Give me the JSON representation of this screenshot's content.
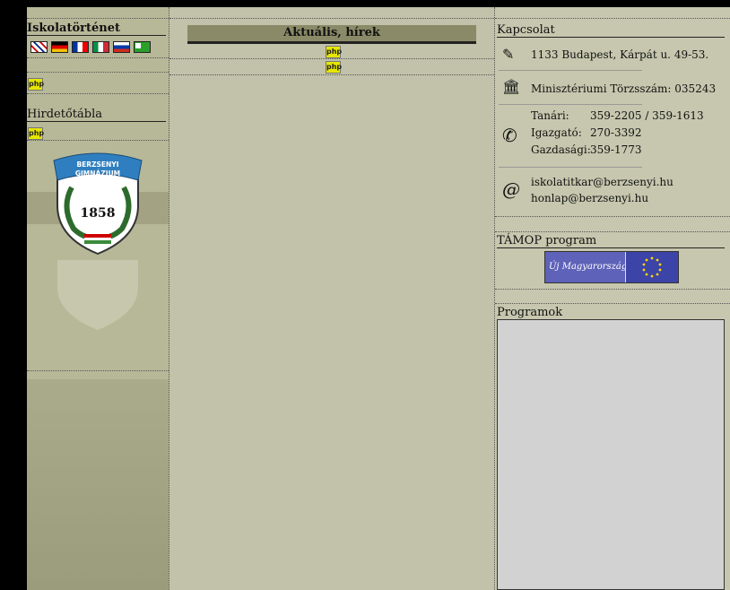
{
  "left": {
    "history_title": "Iskolatörténet",
    "php_label": "php",
    "noticeboard_title": "Hirdetőtábla",
    "logo": {
      "text_top": "BERZSENYI",
      "text_bottom": "GIMNÁZIUM",
      "year": "1858"
    }
  },
  "main": {
    "news_title": "Aktuális, hírek",
    "php_label": "php"
  },
  "right": {
    "contact_title": "Kapcsolat",
    "address": "1133 Budapest, Kárpát u. 49-53.",
    "ministry_id": "Minisztériumi Törzsszám: 035243",
    "phones": [
      {
        "label": "Tanári:",
        "value": "359-2205 / 359-1613"
      },
      {
        "label": "Igazgató:",
        "value": "270-3392"
      },
      {
        "label": "Gazdasági:",
        "value": "359-1773"
      }
    ],
    "emails": [
      "iskolatitkar@berzsenyi.hu",
      "honlap@berzsenyi.hu"
    ],
    "tamop_title": "TÁMOP program",
    "banner_text": "Új Magyarország",
    "programs_title": "Programok"
  },
  "colors": {
    "dark_bg": "#000000",
    "left_bg": "#b7b898",
    "main_bg": "#c1c2a9",
    "right_bg": "#c6c7ae",
    "news_bar": "#8a8a68"
  }
}
